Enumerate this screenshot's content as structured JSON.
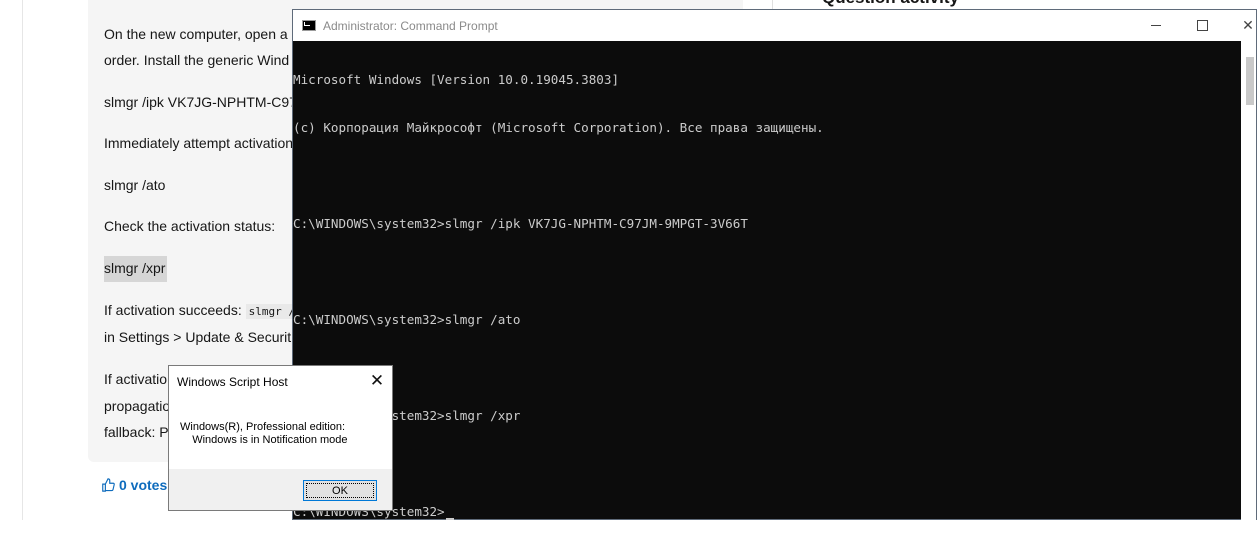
{
  "page": {
    "paragraphs": [
      "On the new computer, open a",
      "order. Install the generic Wind",
      "slmgr /ipk VK7JG-NPHTM-C97",
      "Immediately attempt activation",
      "slmgr /ato",
      "Check the activation status:",
      "slmgr /xpr",
      "If activation succeeds: ",
      "slmgr /",
      "in Settings > Update & Securit",
      "If activatio",
      "propagatio",
      "fallback: Pl"
    ],
    "right_heading": "Question activity",
    "votes": {
      "count_label": "0 votes",
      "icon": "thumbs-up-icon"
    }
  },
  "cmd": {
    "title": "Administrator: Command Prompt",
    "icon": "cmd-icon",
    "controls": {
      "minimize": "minimize-icon",
      "maximize": "maximize-icon",
      "close": "✕"
    },
    "lines": [
      "Microsoft Windows [Version 10.0.19045.3803]",
      "(c) Корпорация Майкрософт (Microsoft Corporation). Все права защищены.",
      "",
      "C:\\WINDOWS\\system32>slmgr /ipk VK7JG-NPHTM-C97JM-9MPGT-3V66T",
      "",
      "C:\\WINDOWS\\system32>slmgr /ato",
      "",
      "C:\\WINDOWS\\system32>slmgr /xpr",
      "",
      "C:\\WINDOWS\\system32>"
    ]
  },
  "dialog": {
    "title": "Windows Script Host",
    "close": "✕",
    "message": "Windows(R), Professional edition:\n    Windows is in Notification mode",
    "ok_label": "OK"
  }
}
